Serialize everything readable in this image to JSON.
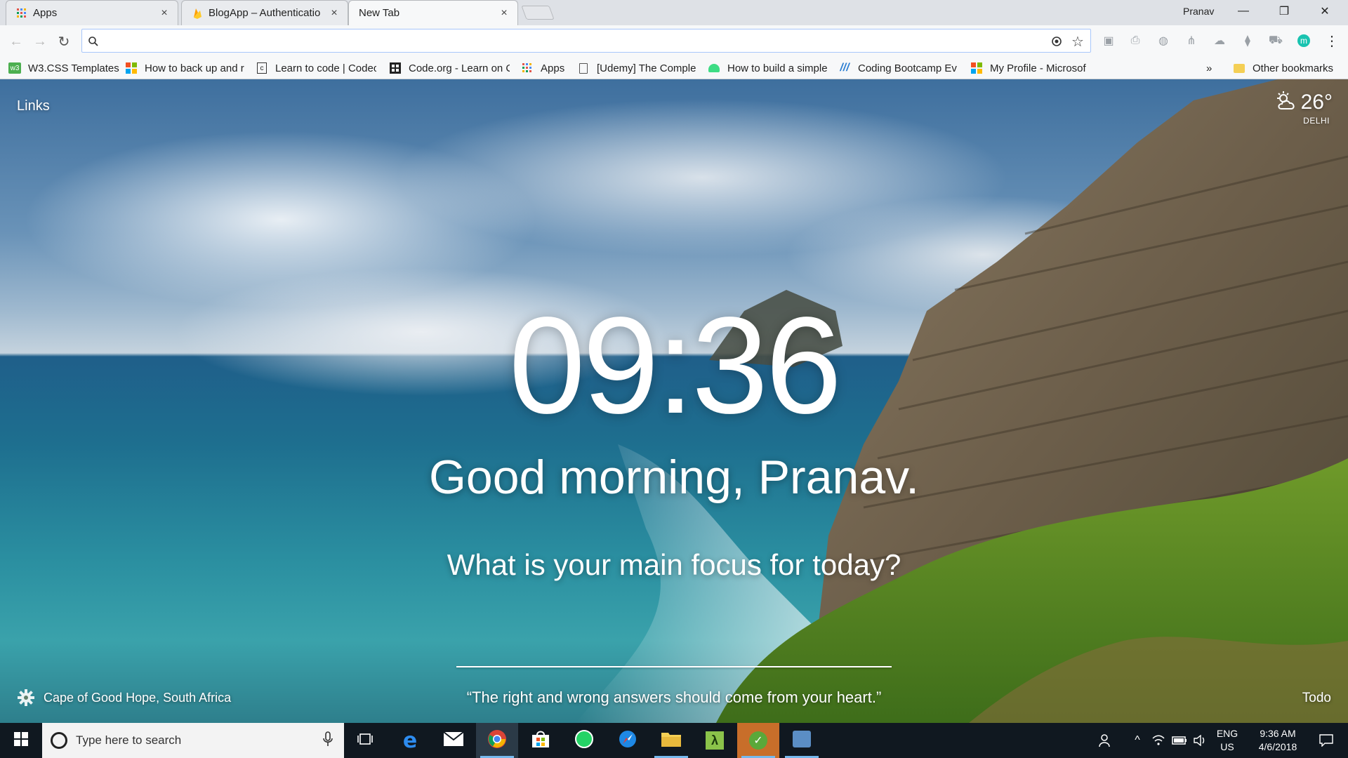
{
  "browser": {
    "tabs": [
      {
        "title": "Apps",
        "close": "×"
      },
      {
        "title": "BlogApp – Authenticatio",
        "close": "×"
      },
      {
        "title": "New Tab",
        "close": "×"
      }
    ],
    "profile_name": "Pranav",
    "window_controls": {
      "minimize": "—",
      "restore": "❐",
      "close": "✕"
    },
    "omnibox": {
      "value": "",
      "placeholder": ""
    },
    "bookmarks": [
      {
        "label": "W3.CSS Templates",
        "icon": "w3-icon"
      },
      {
        "label": "How to back up and r",
        "icon": "microsoft-icon"
      },
      {
        "label": "Learn to code | Codec",
        "icon": "codecademy-icon"
      },
      {
        "label": "Code.org - Learn on C",
        "icon": "codeorg-icon"
      },
      {
        "label": "Apps",
        "icon": "apps-grid-icon"
      },
      {
        "label": "[Udemy] The Comple",
        "icon": "page-icon"
      },
      {
        "label": "How to build a simple",
        "icon": "android-icon"
      },
      {
        "label": "Coding Bootcamp Ev",
        "icon": "bootcamp-icon"
      },
      {
        "label": "My Profile - Microsof",
        "icon": "microsoft-icon"
      }
    ],
    "bookmarks_overflow": "»",
    "other_bookmarks": "Other bookmarks"
  },
  "momentum": {
    "links_label": "Links",
    "weather": {
      "temp": "26°",
      "city": "DELHI",
      "icon": "partly-cloudy-icon"
    },
    "clock": "09:36",
    "greeting": "Good morning, Pranav.",
    "focus_question": "What is your main focus for today?",
    "focus_value": "",
    "location": "Cape of Good Hope, South Africa",
    "quote": "“The right and wrong answers should come from your heart.”",
    "todo_label": "Todo"
  },
  "taskbar": {
    "search_placeholder": "Type here to search",
    "language": "ENG",
    "region": "US",
    "time": "9:36 AM",
    "date": "4/6/2018"
  },
  "colors": {
    "chrome_frame": "#dee1e6",
    "toolbar": "#f7f8f9",
    "taskbar": "#101820",
    "accent": "#76b9ed"
  }
}
